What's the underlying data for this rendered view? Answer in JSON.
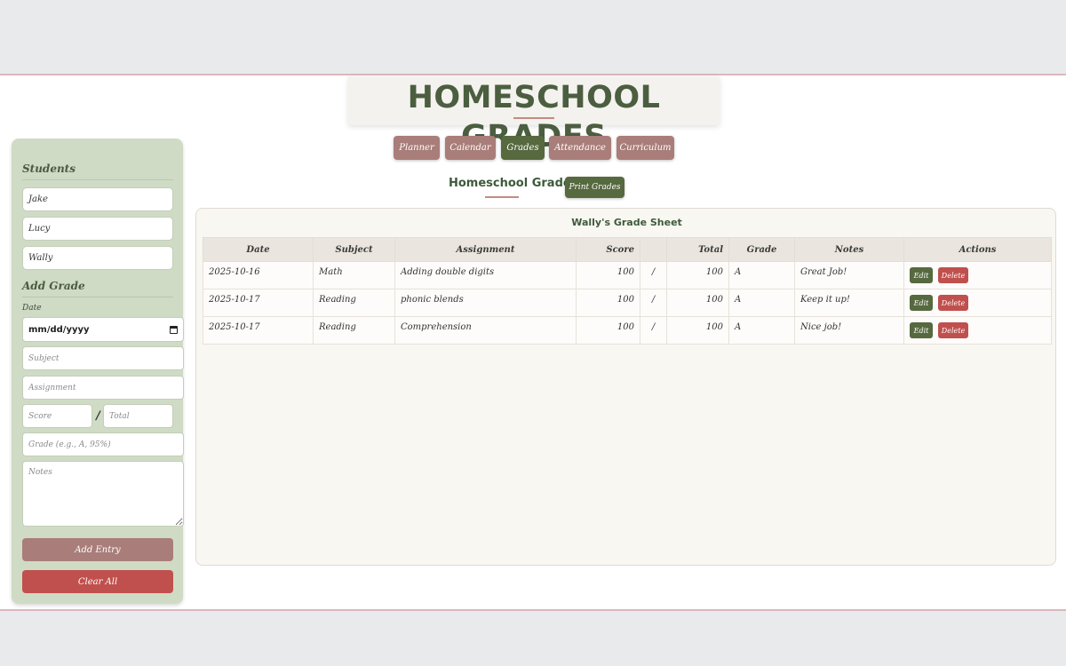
{
  "app": {
    "title": "HOMESCHOOL GRADES"
  },
  "nav": {
    "items": [
      {
        "label": "Planner",
        "active": false
      },
      {
        "label": "Calendar",
        "active": false
      },
      {
        "label": "Grades",
        "active": true
      },
      {
        "label": "Attendance",
        "active": false
      },
      {
        "label": "Curriculum",
        "active": false
      }
    ]
  },
  "sidebar": {
    "students_heading": "Students",
    "students": [
      "Jake",
      "Lucy",
      "Wally"
    ],
    "add_heading": "Add Grade",
    "date_label": "Date",
    "date_value": "mm/dd/yyyy",
    "subject_placeholder": "Subject",
    "assignment_placeholder": "Assignment",
    "score_placeholder": "Score",
    "slash": "/",
    "total_placeholder": "Total",
    "grade_placeholder": "Grade (e.g., A, 95%)",
    "notes_placeholder": "Notes",
    "add_button": "Add Entry",
    "clear_button": "Clear All"
  },
  "main": {
    "section_title": "Homeschool Grades",
    "print_button": "Print Grades",
    "sheet_title": "Wally's Grade Sheet",
    "columns": [
      "Date",
      "Subject",
      "Assignment",
      "Score",
      "",
      "Total",
      "Grade",
      "Notes",
      "Actions"
    ],
    "rows": [
      {
        "date": "2025-10-16",
        "subject": "Math",
        "assignment": "Adding double digits",
        "score": "100",
        "slash": "/",
        "total": "100",
        "grade": "A",
        "notes": "Great Job!"
      },
      {
        "date": "2025-10-17",
        "subject": "Reading",
        "assignment": "phonic blends",
        "score": "100",
        "slash": "/",
        "total": "100",
        "grade": "A",
        "notes": "Keep it up!"
      },
      {
        "date": "2025-10-17",
        "subject": "Reading",
        "assignment": "Comprehension",
        "score": "100",
        "slash": "/",
        "total": "100",
        "grade": "A",
        "notes": "Nice job!"
      }
    ],
    "edit_label": "Edit",
    "delete_label": "Delete"
  },
  "colors": {
    "accent_green": "#56693f",
    "accent_rose": "#a97d79",
    "danger": "#c0504d",
    "sidebar_bg": "#cfdbc5"
  }
}
